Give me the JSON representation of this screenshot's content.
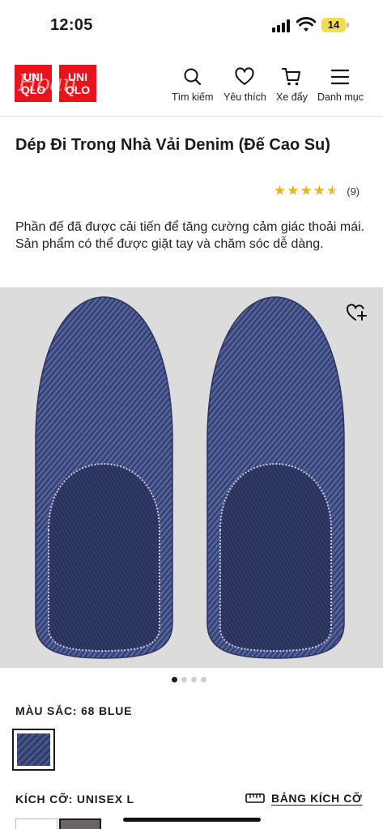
{
  "status_bar": {
    "time": "12:05",
    "battery": "14"
  },
  "header": {
    "logo": {
      "line1": "UNI",
      "line2": "QLO",
      "watermark": "Hoàn"
    },
    "nav": [
      {
        "label": "Tìm kiếm",
        "icon": "search-icon"
      },
      {
        "label": "Yêu thích",
        "icon": "heart-icon"
      },
      {
        "label": "Xe đẩy",
        "icon": "cart-icon"
      },
      {
        "label": "Danh mục",
        "icon": "menu-icon"
      }
    ]
  },
  "product": {
    "title": "Dép Đi Trong Nhà Vải Denim (Đế Cao Su)",
    "rating": {
      "stars": 4.5,
      "count": "(9)"
    },
    "description": "Phần đế đã được cải tiến để tăng cường cảm giác thoải mái. Sản phẩm có thể được giặt tay và chăm sóc dễ dàng.",
    "image_icon": "wishlist-add-icon",
    "carousel": {
      "total": 4,
      "active": 1
    },
    "color_label": "MÀU SẮC: 68 BLUE",
    "size_label": "KÍCH CỠ: UNISEX L",
    "size_guide_label": "BẢNG KÍCH CỠ"
  },
  "colors": {
    "brand_red": "#e8131b",
    "star": "#e7b417",
    "denim": "#3a4776"
  }
}
